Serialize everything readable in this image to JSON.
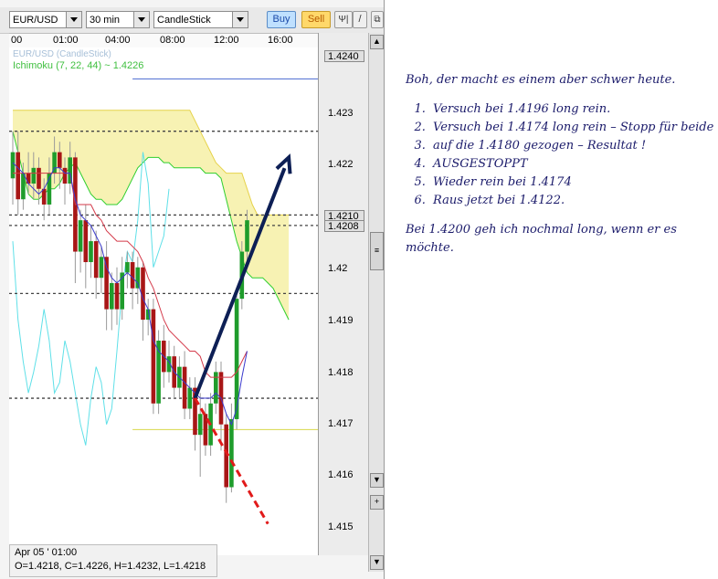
{
  "toolbar": {
    "symbol": "EUR/USD",
    "timeframe": "30 min",
    "chart_type": "CandleStick",
    "buy_label": "Buy",
    "sell_label": "Sell",
    "tool_a": "Ψ|",
    "tool_b": "/",
    "tool_c": "⧉"
  },
  "legend": {
    "series": "EUR/USD (CandleStick)",
    "ichimoku": "Ichimoku (7, 22, 44) ~ 1.4226"
  },
  "status": {
    "date": "Apr 05 ' 01:00",
    "ohlc": "O=1.4218, C=1.4226, H=1.4232, L=1.4218"
  },
  "price_badges": {
    "top": "1.4240",
    "a": "1.4210",
    "b": "1.4208"
  },
  "colors": {
    "bull": "#1f9c2c",
    "bear": "#a81616",
    "tenkan": "#3a3acc",
    "kijun": "#d43a4a",
    "chikou": "#5fe0e8",
    "span_a": "#2fcf2f",
    "cloud": "#f4ee9a",
    "arrow": "#0d1f55",
    "dashed_red": "#e11a1a"
  },
  "notes": {
    "intro": "Boh, der macht es einem aber schwer heute.",
    "items": [
      "Versuch bei 1.4196 long rein.",
      "Versuch bei 1.4174 long rein – Stopp für beide",
      "auf die 1.4180 gezogen – Resultat  !",
      "AUSGESTOPPT",
      "Wieder rein bei 1.4174",
      "Raus jetzt bei 1.4122."
    ],
    "outro": "Bei 1.4200 geh ich nochmal long, wenn er es möchte."
  },
  "chart_data": {
    "type": "candlestick",
    "title": "",
    "xlabel": "",
    "ylabel": "",
    "x_ticks": [
      "00",
      "01:00",
      "04:00",
      "08:00",
      "12:00",
      "16:00"
    ],
    "y_ticks": [
      1.415,
      1.416,
      1.417,
      1.418,
      1.419,
      1.42,
      1.421,
      1.422,
      1.423
    ],
    "ylim": [
      1.4145,
      1.4242
    ],
    "grid": false,
    "candles": [
      {
        "o": 1.4217,
        "c": 1.4222,
        "h": 1.4226,
        "l": 1.4212
      },
      {
        "o": 1.4222,
        "c": 1.4213,
        "h": 1.4226,
        "l": 1.421
      },
      {
        "o": 1.4213,
        "c": 1.4218,
        "h": 1.422,
        "l": 1.4211
      },
      {
        "o": 1.4218,
        "c": 1.4216,
        "h": 1.4222,
        "l": 1.4214
      },
      {
        "o": 1.4216,
        "c": 1.4219,
        "h": 1.4222,
        "l": 1.4213
      },
      {
        "o": 1.4219,
        "c": 1.4215,
        "h": 1.4221,
        "l": 1.4212
      },
      {
        "o": 1.4215,
        "c": 1.4212,
        "h": 1.4217,
        "l": 1.4209
      },
      {
        "o": 1.4212,
        "c": 1.4218,
        "h": 1.4221,
        "l": 1.421
      },
      {
        "o": 1.4218,
        "c": 1.4222,
        "h": 1.4225,
        "l": 1.4216
      },
      {
        "o": 1.4222,
        "c": 1.4219,
        "h": 1.4224,
        "l": 1.4215
      },
      {
        "o": 1.4219,
        "c": 1.4216,
        "h": 1.4221,
        "l": 1.4212
      },
      {
        "o": 1.4216,
        "c": 1.4221,
        "h": 1.4224,
        "l": 1.4214
      },
      {
        "o": 1.4221,
        "c": 1.4203,
        "h": 1.4222,
        "l": 1.4197
      },
      {
        "o": 1.4203,
        "c": 1.4209,
        "h": 1.4211,
        "l": 1.4199
      },
      {
        "o": 1.4209,
        "c": 1.4201,
        "h": 1.4212,
        "l": 1.4196
      },
      {
        "o": 1.4201,
        "c": 1.4205,
        "h": 1.4208,
        "l": 1.4198
      },
      {
        "o": 1.4205,
        "c": 1.4198,
        "h": 1.4207,
        "l": 1.4194
      },
      {
        "o": 1.4198,
        "c": 1.4202,
        "h": 1.4204,
        "l": 1.4195
      },
      {
        "o": 1.4202,
        "c": 1.4192,
        "h": 1.4205,
        "l": 1.4188
      },
      {
        "o": 1.4192,
        "c": 1.4197,
        "h": 1.4199,
        "l": 1.4188
      },
      {
        "o": 1.4197,
        "c": 1.4192,
        "h": 1.42,
        "l": 1.4189
      },
      {
        "o": 1.4192,
        "c": 1.4199,
        "h": 1.4202,
        "l": 1.419
      },
      {
        "o": 1.4199,
        "c": 1.4201,
        "h": 1.4203,
        "l": 1.4196
      },
      {
        "o": 1.4201,
        "c": 1.4196,
        "h": 1.4203,
        "l": 1.4192
      },
      {
        "o": 1.4196,
        "c": 1.42,
        "h": 1.4202,
        "l": 1.4193
      },
      {
        "o": 1.42,
        "c": 1.419,
        "h": 1.4201,
        "l": 1.4186
      },
      {
        "o": 1.419,
        "c": 1.4192,
        "h": 1.4194,
        "l": 1.4187
      },
      {
        "o": 1.4192,
        "c": 1.4174,
        "h": 1.4194,
        "l": 1.4172
      },
      {
        "o": 1.4174,
        "c": 1.4186,
        "h": 1.4188,
        "l": 1.4172
      },
      {
        "o": 1.4186,
        "c": 1.418,
        "h": 1.4189,
        "l": 1.4177
      },
      {
        "o": 1.418,
        "c": 1.4183,
        "h": 1.4186,
        "l": 1.4178
      },
      {
        "o": 1.4183,
        "c": 1.4177,
        "h": 1.4185,
        "l": 1.4175
      },
      {
        "o": 1.4177,
        "c": 1.4181,
        "h": 1.4183,
        "l": 1.4175
      },
      {
        "o": 1.4181,
        "c": 1.4173,
        "h": 1.4184,
        "l": 1.4171
      },
      {
        "o": 1.4173,
        "c": 1.4177,
        "h": 1.4179,
        "l": 1.4171
      },
      {
        "o": 1.4177,
        "c": 1.4168,
        "h": 1.4179,
        "l": 1.4165
      },
      {
        "o": 1.4168,
        "c": 1.4172,
        "h": 1.4176,
        "l": 1.416
      },
      {
        "o": 1.4172,
        "c": 1.4166,
        "h": 1.4174,
        "l": 1.4164
      },
      {
        "o": 1.4166,
        "c": 1.4174,
        "h": 1.4176,
        "l": 1.4164
      },
      {
        "o": 1.4174,
        "c": 1.418,
        "h": 1.4182,
        "l": 1.4172
      },
      {
        "o": 1.418,
        "c": 1.417,
        "h": 1.4182,
        "l": 1.4165
      },
      {
        "o": 1.417,
        "c": 1.4158,
        "h": 1.4172,
        "l": 1.4155
      },
      {
        "o": 1.4158,
        "c": 1.4171,
        "h": 1.4174,
        "l": 1.4157
      },
      {
        "o": 1.4171,
        "c": 1.4194,
        "h": 1.4196,
        "l": 1.4169
      },
      {
        "o": 1.4194,
        "c": 1.4203,
        "h": 1.4205,
        "l": 1.4192
      },
      {
        "o": 1.4203,
        "c": 1.4209,
        "h": 1.4211,
        "l": 1.4201
      }
    ],
    "ichimoku": {
      "tenkan": [
        1.422,
        1.4219,
        1.4218,
        1.4216,
        1.4215,
        1.4214,
        1.4215,
        1.4217,
        1.4219,
        1.4219,
        1.4218,
        1.4218,
        1.4213,
        1.421,
        1.4209,
        1.4208,
        1.4206,
        1.4204,
        1.42,
        1.4198,
        1.4197,
        1.4198,
        1.4199,
        1.4198,
        1.4197,
        1.4194,
        1.4192,
        1.4186,
        1.4184,
        1.4183,
        1.4182,
        1.418,
        1.4179,
        1.4178,
        1.4177,
        1.4176,
        1.4175,
        1.4175,
        1.4175,
        1.4176,
        1.4175,
        1.4172,
        1.417,
        1.4173,
        1.4179,
        1.4184
      ],
      "kijun": [
        1.4218,
        1.4218,
        1.4218,
        1.4218,
        1.4218,
        1.4218,
        1.4218,
        1.4218,
        1.4218,
        1.4218,
        1.4218,
        1.4218,
        1.4212,
        1.4212,
        1.4212,
        1.4212,
        1.421,
        1.4209,
        1.4207,
        1.4206,
        1.4205,
        1.4205,
        1.4205,
        1.4204,
        1.4203,
        1.4201,
        1.4198,
        1.4196,
        1.4193,
        1.419,
        1.4188,
        1.4187,
        1.4186,
        1.4185,
        1.4184,
        1.4184,
        1.4183,
        1.418,
        1.4179,
        1.4179,
        1.4179,
        1.4179,
        1.4179,
        1.418,
        1.4182,
        1.4184
      ],
      "chikou": [
        1.4205,
        1.419,
        1.4182,
        1.4176,
        1.418,
        1.4185,
        1.4192,
        1.4186,
        1.4176,
        1.4178,
        1.4186,
        1.4182,
        1.4176,
        1.417,
        1.4166,
        1.4175,
        1.4181,
        1.4178,
        1.417,
        1.4173,
        1.4184,
        1.4196,
        1.4203,
        1.4201,
        1.4209,
        1.4222,
        1.4216,
        1.42,
        1.4203,
        1.4206,
        1.4215
      ],
      "span_a": [
        1.4226,
        1.4222,
        1.4218,
        1.4214,
        1.4213,
        1.4213,
        1.4214,
        1.4215,
        1.4215,
        1.4216,
        1.4218,
        1.4219,
        1.422,
        1.4218,
        1.4216,
        1.4214,
        1.4213,
        1.4213,
        1.4212,
        1.4212,
        1.4212,
        1.4213,
        1.4215,
        1.4217,
        1.4219,
        1.422,
        1.4221,
        1.4221,
        1.4221,
        1.422,
        1.422,
        1.4219,
        1.4219,
        1.4219,
        1.4219,
        1.4219,
        1.4219,
        1.4218,
        1.4218,
        1.4218,
        1.4217,
        1.4213,
        1.4209,
        1.4205,
        1.4202,
        1.4199,
        1.4198,
        1.4198,
        1.4198,
        1.4197,
        1.4196,
        1.4194,
        1.4192,
        1.419
      ],
      "span_b": [
        1.423,
        1.423,
        1.423,
        1.423,
        1.423,
        1.423,
        1.423,
        1.423,
        1.423,
        1.423,
        1.423,
        1.423,
        1.423,
        1.423,
        1.423,
        1.423,
        1.423,
        1.423,
        1.423,
        1.423,
        1.423,
        1.423,
        1.423,
        1.423,
        1.423,
        1.423,
        1.423,
        1.423,
        1.423,
        1.423,
        1.423,
        1.423,
        1.423,
        1.423,
        1.423,
        1.4228,
        1.4226,
        1.4224,
        1.4222,
        1.422,
        1.4219,
        1.4218,
        1.4218,
        1.4218,
        1.4218,
        1.4215,
        1.4212,
        1.421,
        1.421,
        1.421,
        1.421,
        1.421,
        1.421,
        1.421
      ]
    },
    "levels": [
      {
        "price": 1.4226,
        "style": "dotted",
        "color": "#444444"
      },
      {
        "price": 1.421,
        "style": "dotted",
        "color": "#444444"
      },
      {
        "price": 1.4208,
        "style": "dotted",
        "color": "#444444"
      },
      {
        "price": 1.4195,
        "style": "dotted",
        "color": "#444444"
      },
      {
        "price": 1.4175,
        "style": "dotted",
        "color": "#444444"
      },
      {
        "price": 1.4236,
        "style": "solid",
        "color": "#4a6ad0",
        "from": 23
      },
      {
        "price": 1.4169,
        "style": "solid",
        "color": "#d8d84a",
        "from": 23
      }
    ],
    "annotations": [
      {
        "type": "arrow",
        "from": {
          "i": 35,
          "p": 1.4175
        },
        "to": {
          "i": 53,
          "p": 1.4221
        },
        "color": "#0d1f55"
      },
      {
        "type": "dashed-line",
        "from": {
          "i": 35,
          "p": 1.4175
        },
        "to": {
          "i": 49,
          "p": 1.4151
        },
        "color": "#e11a1a"
      }
    ]
  }
}
